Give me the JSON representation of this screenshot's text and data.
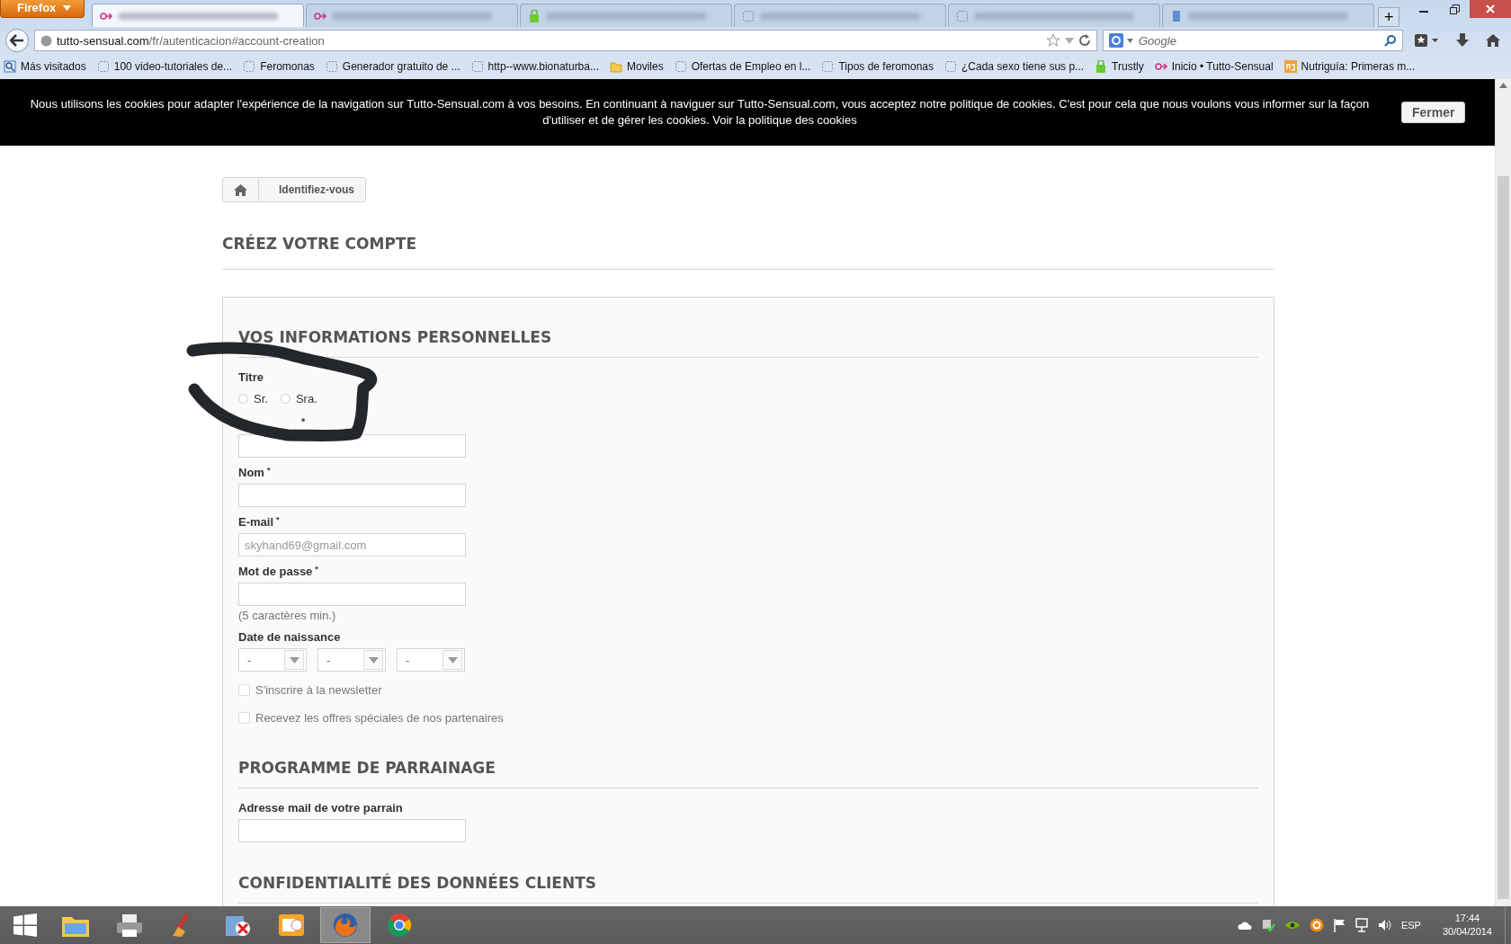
{
  "browser": {
    "menu_button": "Firefox",
    "new_tab": "+",
    "tabs": [
      {
        "kind": "site",
        "selected": true
      },
      {
        "kind": "site",
        "selected": false
      },
      {
        "kind": "app",
        "selected": false
      },
      {
        "kind": "page",
        "selected": false
      },
      {
        "kind": "page",
        "selected": false
      },
      {
        "kind": "doc",
        "selected": false
      }
    ],
    "address_bar": {
      "domain": "tutto-sensual.com",
      "path": "/fr/autenticacion#account-creation"
    },
    "search": {
      "placeholder": "Google"
    },
    "bookmarks": [
      {
        "kind": "special",
        "label": "Más visitados"
      },
      {
        "kind": "page",
        "label": "100 video-tutoriales de..."
      },
      {
        "kind": "page",
        "label": "Feromonas"
      },
      {
        "kind": "page",
        "label": "Generador gratuito de ..."
      },
      {
        "kind": "page",
        "label": "http--www.bionaturba..."
      },
      {
        "kind": "folder",
        "label": "Moviles"
      },
      {
        "kind": "page",
        "label": "Ofertas de Empleo en l..."
      },
      {
        "kind": "page",
        "label": "Tipos de feromonas"
      },
      {
        "kind": "page",
        "label": "¿Cada sexo tiene sus p..."
      },
      {
        "kind": "app",
        "label": "Trustly"
      },
      {
        "kind": "site",
        "label": "Inicio • Tutto-Sensual"
      },
      {
        "kind": "ng",
        "label": "Nutriguía: Primeras m..."
      }
    ]
  },
  "cookie_banner": {
    "text": "Nous utilisons les cookies pour adapter l'expérience de la navigation sur Tutto-Sensual.com à vos besoins. En continuant à naviguer sur Tutto-Sensual.com, vous acceptez notre politique de cookies. C'est pour cela que nous voulons vous informer sur la façon d'utiliser et de gérer les cookies. Voir la politique des cookies",
    "button": "Fermer"
  },
  "breadcrumb": {
    "current": "Identifiez-vous"
  },
  "page_title": "CRÉEZ VOTRE COMPTE",
  "sections": [
    {
      "title": "VOS INFORMATIONS PERSONNELLES",
      "fields": [
        {
          "kind": "radio",
          "label": "Titre",
          "options": [
            {
              "label": "Sr.",
              "selected": false
            },
            {
              "label": "Sra.",
              "selected": false
            }
          ]
        },
        {
          "kind": "text",
          "mark": "*"
        },
        {
          "kind": "text",
          "label": "Nom",
          "mark": "*"
        },
        {
          "kind": "text",
          "label": "E-mail",
          "mark": "*",
          "placeholder": "skyhand69@gmail.com"
        },
        {
          "kind": "text",
          "label": "Mot de passe",
          "mark": "*",
          "hint": "(5 caractères min.)"
        },
        {
          "kind": "date",
          "label": "Date de naissance",
          "selects": [
            {
              "value": "-"
            },
            {
              "value": "-"
            },
            {
              "value": "-"
            }
          ]
        },
        {
          "kind": "checkbox",
          "label": "S'inscrire à la newsletter",
          "checked": false
        },
        {
          "kind": "checkbox",
          "label": "Recevez les offres spéciales de nos partenaires",
          "checked": false
        }
      ]
    },
    {
      "title": "PROGRAMME DE PARRAINAGE",
      "fields": [
        {
          "kind": "text",
          "label": "Adresse mail de votre parrain"
        }
      ]
    },
    {
      "title": "CONFIDENTIALITÉ DES DONNÉES CLIENTS"
    }
  ],
  "taskbar": {
    "apps": [
      {
        "kind": "explorer",
        "selected": false
      },
      {
        "kind": "printer",
        "selected": false
      },
      {
        "kind": "cleaner",
        "selected": false
      },
      {
        "kind": "uninstaller",
        "selected": false
      },
      {
        "kind": "mail",
        "selected": false
      },
      {
        "kind": "firefox",
        "selected": true
      },
      {
        "kind": "chrome",
        "selected": false
      }
    ],
    "language": "ESP",
    "time": "17:44",
    "date": "30/04/2014"
  }
}
